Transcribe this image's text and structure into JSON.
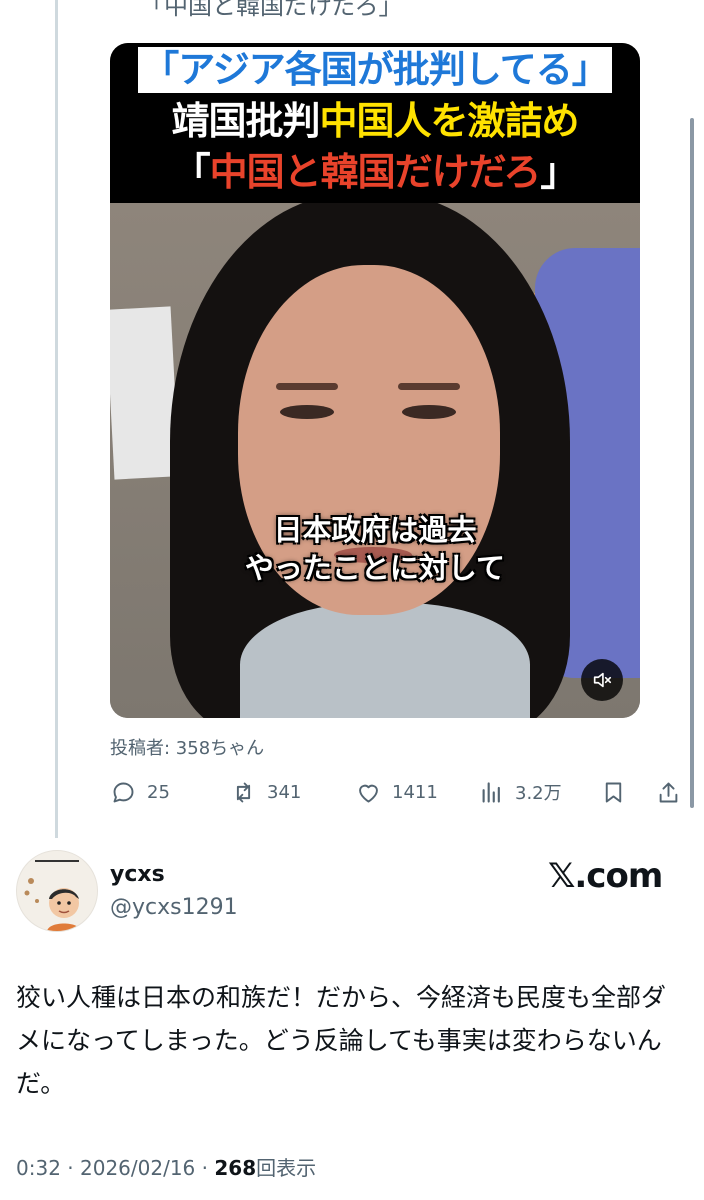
{
  "previous_tweet": {
    "top_cut_text": "「中国と韓国だけだろ」",
    "video": {
      "caption_line1": "「アジア各国が批判してる」",
      "caption_line2_part1": "靖国批判",
      "caption_line2_part2": "中国人を激詰め",
      "caption_line3_open": "「",
      "caption_line3_red": "中国と韓国だけだろ",
      "caption_line3_close": "」",
      "subtitle_line1": "日本政府は過去",
      "subtitle_line2": "やったことに対して",
      "mute_icon": "speaker-muted-icon"
    },
    "author_credit": "投稿者: 358ちゃん",
    "actions": {
      "replies": "25",
      "reposts": "341",
      "likes": "1411",
      "views": "3.2万"
    }
  },
  "tweet": {
    "display_name": "ycxs",
    "handle": "@ycxs1291",
    "brand": "𝕏.com",
    "text": "狡い人種は日本の和族だ！だから、今経済も民度も全部ダメになってしまった。どう反論しても事実は変わらないんだ。",
    "time": "0:32",
    "separator": "·",
    "date": "2026/02/16",
    "view_count": "268",
    "view_label": "回表示"
  },
  "colors": {
    "text": "#0f1419",
    "secondary": "#536471",
    "caption_blue": "#1e78d8",
    "caption_yellow": "#ffe200",
    "caption_red": "#e9432b"
  }
}
